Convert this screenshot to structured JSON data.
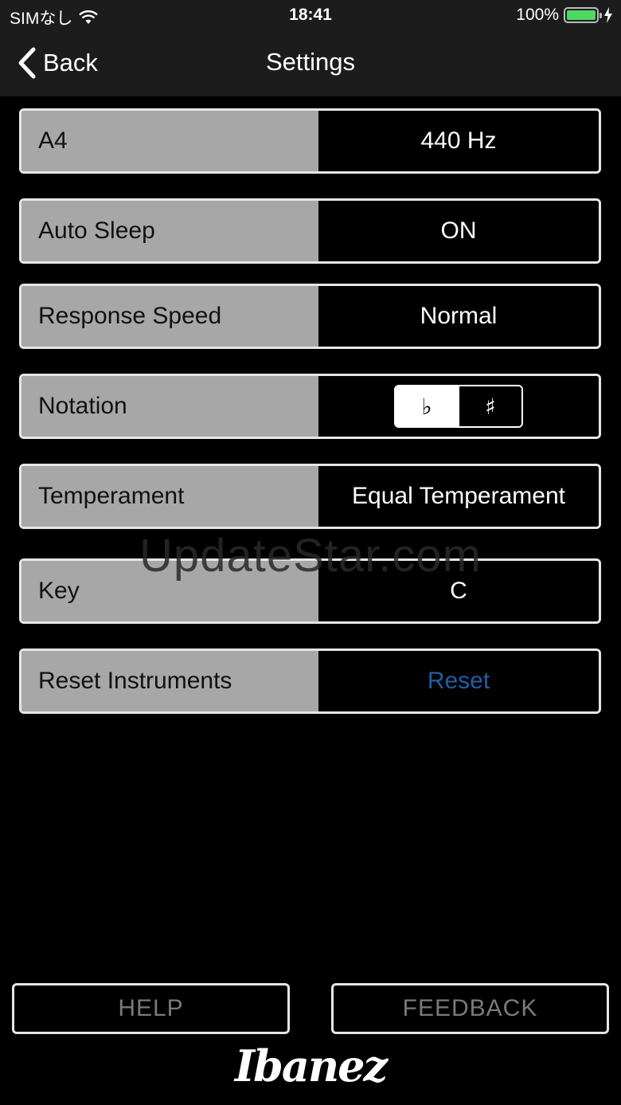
{
  "status_bar": {
    "carrier": "SIMなし",
    "time": "18:41",
    "battery": "100%",
    "battery_level": 1.0,
    "icons": [
      "wifi-icon",
      "battery-icon",
      "charging-icon"
    ]
  },
  "nav": {
    "back_label": "Back",
    "title": "Settings"
  },
  "settings": [
    {
      "label": "A4",
      "value": "440 Hz"
    },
    {
      "label": "Auto Sleep",
      "value": "ON"
    },
    {
      "label": "Response Speed",
      "value": "Normal"
    },
    {
      "label": "Notation",
      "flat": "♭",
      "sharp": "♯",
      "selected": "flat"
    },
    {
      "label": "Temperament",
      "value": "Equal Temperament"
    },
    {
      "label": "Key",
      "value": "C"
    },
    {
      "label": "Reset Instruments",
      "value": "Reset"
    }
  ],
  "watermark": "UpdateStar.com",
  "buttons": {
    "help": "HELP",
    "feedback": "FEEDBACK"
  },
  "logo": "Ibanez",
  "colors": {
    "label_bg": "#a7a7a7",
    "reset_link": "#1f5fa3",
    "battery_fill": "#4cd964"
  }
}
